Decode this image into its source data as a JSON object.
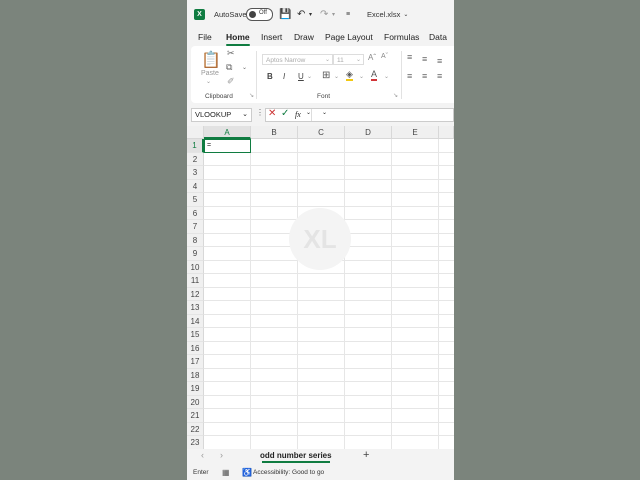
{
  "titlebar": {
    "app_icon": "excel-logo",
    "logo_letter": "X",
    "autosave_label": "AutoSave",
    "autosave_state": "Off",
    "filename": "Excel.xlsx"
  },
  "tabs": [
    "File",
    "Home",
    "Insert",
    "Draw",
    "Page Layout",
    "Formulas",
    "Data"
  ],
  "active_tab": "Home",
  "ribbon": {
    "clipboard_label": "Clipboard",
    "paste_label": "Paste",
    "font_group_label": "Font",
    "font_name": "Aptos Narrow",
    "font_size": "11",
    "bold": "B",
    "italic": "I",
    "underline": "U"
  },
  "formula_bar": {
    "name_box": "VLOOKUP",
    "fx": "fx",
    "content": ""
  },
  "grid": {
    "columns": [
      "A",
      "B",
      "C",
      "D",
      "E"
    ],
    "rows": [
      "1",
      "2",
      "3",
      "4",
      "5",
      "6",
      "7",
      "8",
      "9",
      "10",
      "11",
      "12",
      "13",
      "14",
      "15",
      "16",
      "17",
      "18",
      "19",
      "20",
      "21",
      "22",
      "23"
    ],
    "active_cell_value": "=",
    "watermark": "XL"
  },
  "sheets": {
    "active_sheet": "odd number series",
    "add_sheet": "+"
  },
  "status": {
    "mode": "Enter",
    "accessibility": "Accessibility: Good to go"
  },
  "colors": {
    "accent": "#107c41",
    "background": "#7b847c"
  }
}
